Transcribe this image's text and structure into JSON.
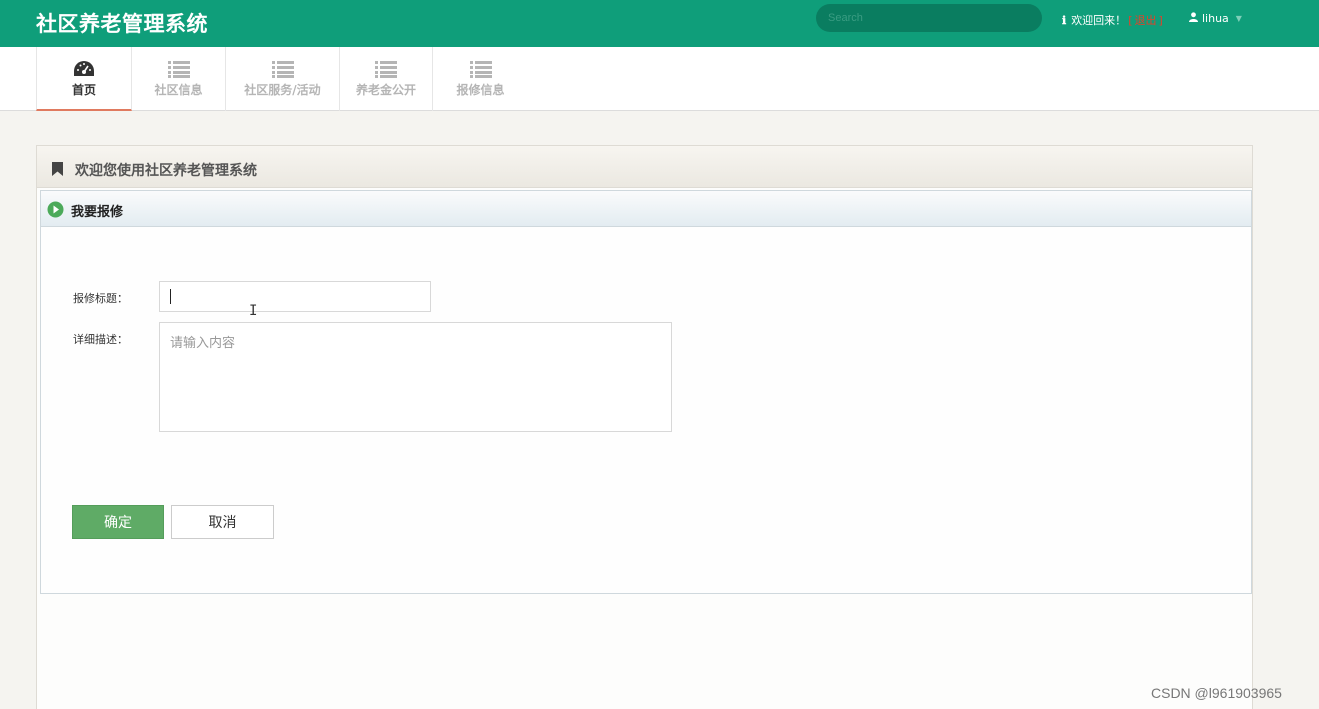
{
  "header": {
    "app_title": "社区养老管理系统",
    "search_placeholder": "Search",
    "welcome_text": "欢迎回来！",
    "logout_prefix": "[",
    "logout_label": "退出",
    "logout_suffix": "]",
    "username": "lihua",
    "colors": {
      "brand": "#0f9e7a",
      "logout": "#e2412a"
    }
  },
  "nav": {
    "items": [
      {
        "label": "首页",
        "icon": "dashboard-icon",
        "active": true
      },
      {
        "label": "社区信息",
        "icon": "list-icon",
        "active": false
      },
      {
        "label": "社区服务/活动",
        "icon": "list-icon",
        "active": false
      },
      {
        "label": "养老金公开",
        "icon": "list-icon",
        "active": false
      },
      {
        "label": "报修信息",
        "icon": "list-icon",
        "active": false
      }
    ]
  },
  "panel": {
    "title": "欢迎您使用社区养老管理系统",
    "icon": "bookmark-icon"
  },
  "form": {
    "title": "我要报修",
    "icon": "play-circle-icon",
    "title_label": "报修标题：",
    "title_value": "",
    "desc_label": "详细描述：",
    "desc_placeholder": "请输入内容",
    "desc_value": "",
    "submit_label": "确定",
    "cancel_label": "取消",
    "colors": {
      "submit": "#5fab66"
    }
  },
  "watermark": "CSDN @l961903965"
}
